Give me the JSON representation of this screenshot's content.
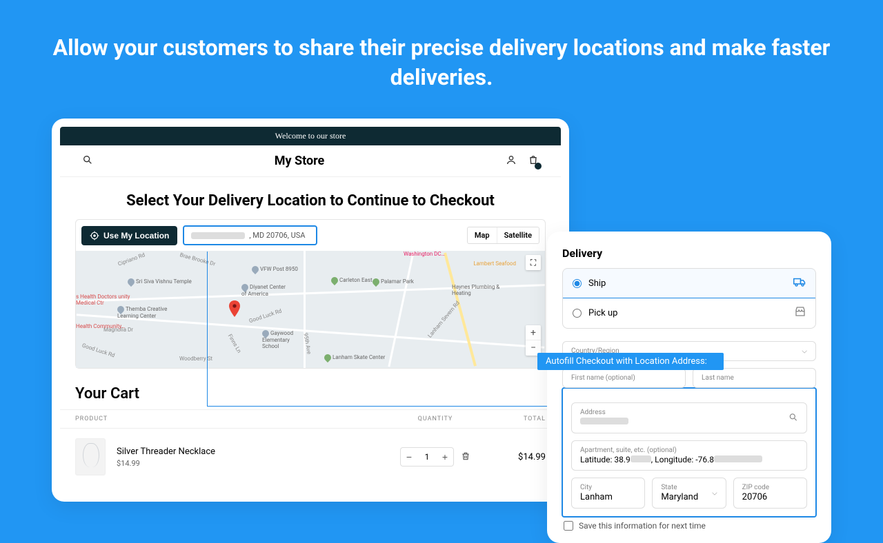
{
  "headline": "Allow your customers to share their precise delivery locations and make faster deliveries.",
  "store": {
    "welcome": "Welcome to our store",
    "name": "My Store"
  },
  "location": {
    "title": "Select Your Delivery Location to Continue to Checkout",
    "use_my_location": "Use My Location",
    "search_suffix": ", MD 20706, USA",
    "map_label": "Map",
    "satellite_label": "Satellite",
    "pois": {
      "washington_dc": "Washington DC…",
      "lambert": "Lambert Seafood",
      "vfw": "VFW Post 8950",
      "diyanet": "Diyanet Center of America",
      "carleton": "Carleton East",
      "palamar": "Palamar Park",
      "haynes": "Haynes Plumbing & Heating",
      "gaywood": "Gaywood Elementary School",
      "skate": "Lanham Skate Center",
      "vishnu": "Sri Siva Vishnu Temple",
      "docs": "s Health Doctors unity Medical Ctr",
      "health": "Health Community…",
      "themba": "Themba Creative Learning Center"
    },
    "roads": {
      "cipriano": "Cipriano Rd",
      "brae": "Brae Brooke Dr",
      "goodluck": "Good Luck Rd",
      "goodluck2": "Good Luck Rd",
      "magnolia": "Magnolia Dr",
      "finns": "Finns Ln",
      "woodberry": "Woodberry St",
      "95th": "95th Ave",
      "severn": "Lanham Severn Rd"
    }
  },
  "cart": {
    "title": "Your Cart",
    "head_product": "PRODUCT",
    "head_qty": "QUANTITY",
    "head_total": "TOTAL",
    "item": {
      "name": "Silver Threader Necklace",
      "price": "$14.99",
      "qty": "1",
      "total": "$14.99"
    }
  },
  "delivery": {
    "title": "Delivery",
    "ship": "Ship",
    "pickup": "Pick up",
    "country_label": "Country/Region",
    "first_name": "First name (optional)",
    "last_name": "Last name",
    "autofill_banner": "Autofill Checkout with Location Address:",
    "address_label": "Address",
    "apt_label": "Apartment, suite, etc. (optional)",
    "lat_prefix": "Latitude: 38.9",
    "lon_prefix": ", Longitude: -76.8",
    "city_label": "City",
    "city_val": "Lanham",
    "state_label": "State",
    "state_val": "Maryland",
    "zip_label": "ZIP code",
    "zip_val": "20706",
    "save_info": "Save this information for next time"
  }
}
